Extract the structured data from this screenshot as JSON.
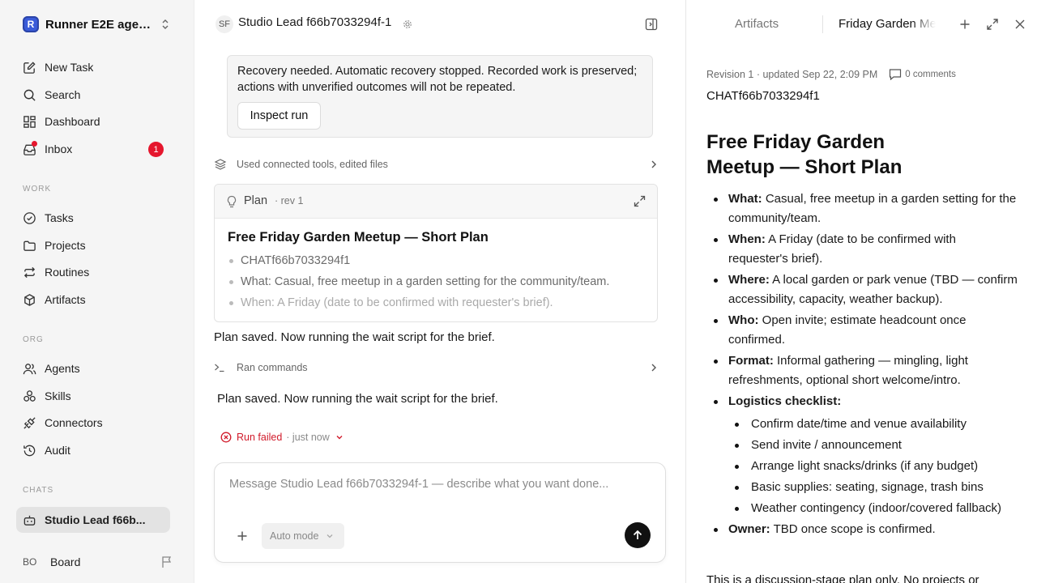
{
  "sidebar": {
    "workspace": {
      "logo": "R",
      "name": "Runner E2E agen..."
    },
    "nav": [
      {
        "label": "New Task",
        "icon": "edit-icon"
      },
      {
        "label": "Search",
        "icon": "search-icon"
      },
      {
        "label": "Dashboard",
        "icon": "dashboard-icon"
      },
      {
        "label": "Inbox",
        "icon": "inbox-icon",
        "badge": "1"
      }
    ],
    "sections": {
      "work": "WORK",
      "org": "ORG",
      "chats": "CHATS"
    },
    "work_items": [
      {
        "label": "Tasks",
        "icon": "check-circle-icon"
      },
      {
        "label": "Projects",
        "icon": "folder-icon"
      },
      {
        "label": "Routines",
        "icon": "repeat-icon"
      },
      {
        "label": "Artifacts",
        "icon": "cube-icon"
      }
    ],
    "org_items": [
      {
        "label": "Agents",
        "icon": "users-icon"
      },
      {
        "label": "Skills",
        "icon": "skills-icon"
      },
      {
        "label": "Connectors",
        "icon": "plug-icon"
      },
      {
        "label": "Audit",
        "icon": "history-icon"
      }
    ],
    "chat_item": {
      "label": "Studio Lead f66b..."
    },
    "board": {
      "avatar": "BO",
      "label": "Board"
    }
  },
  "center": {
    "agent_initials": "SF",
    "agent_title": "Studio Lead f66b7033294f-1",
    "recovery_message": "Recovery needed. Automatic recovery stopped. Recorded work is preserved; actions with unverified outcomes will not be repeated.",
    "inspect_label": "Inspect run",
    "tools_summary": "Used connected tools, edited files",
    "plan": {
      "label": "Plan",
      "rev": "· rev 1",
      "title": "Free Friday Garden Meetup — Short Plan",
      "items": [
        "CHATf66b7033294f1",
        "What: Casual, free meetup in a garden setting for the community/team.",
        "When: A Friday (date to be confirmed with requester's brief)."
      ]
    },
    "message_1": "Plan saved. Now running the wait script for the brief.",
    "commands_summary": "Ran commands",
    "message_2": "Plan saved. Now running the wait script for the brief.",
    "run_status": "Run failed",
    "run_time": "· just now",
    "composer": {
      "placeholder": "Message Studio Lead f66b7033294f-1 — describe what you want done...",
      "mode": "Auto mode"
    }
  },
  "right": {
    "tab_artifacts": "Artifacts",
    "tab_active": "Friday Garden Meetup",
    "meta": "Revision 1 · updated Sep 22, 2:09 PM",
    "comments": "0 comments",
    "doc_id": "CHATf66b7033294f1",
    "doc_title": "Free Friday Garden Meetup — Short Plan",
    "items": [
      {
        "k": "What:",
        "v": " Casual, free meetup in a garden setting for the community/team."
      },
      {
        "k": "When:",
        "v": " A Friday (date to be confirmed with requester's brief)."
      },
      {
        "k": "Where:",
        "v": " A local garden or park venue (TBD — confirm accessibility, capacity, weather backup)."
      },
      {
        "k": "Who:",
        "v": " Open invite; estimate headcount once confirmed."
      },
      {
        "k": "Format:",
        "v": " Informal gathering — mingling, light refreshments, optional short welcome/intro."
      },
      {
        "k": "Logistics checklist:",
        "v": ""
      },
      {
        "k": "Owner:",
        "v": " TBD once scope is confirmed."
      }
    ],
    "checklist": [
      "Confirm date/time and venue availability",
      "Send invite / announcement",
      "Arrange light snacks/drinks (if any budget)",
      "Basic supplies: seating, signage, trash bins",
      "Weather contingency (indoor/covered fallback)"
    ],
    "footer": "This is a discussion-stage plan only. No projects or"
  }
}
